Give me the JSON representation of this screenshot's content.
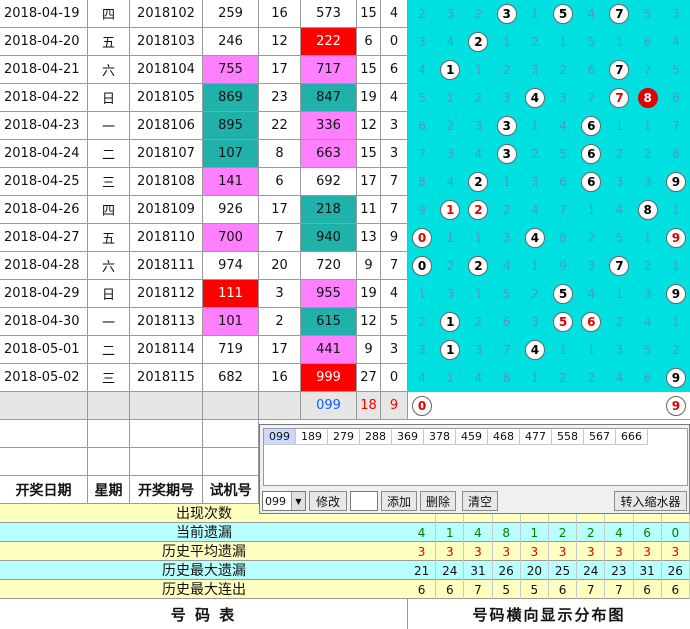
{
  "rows": [
    {
      "date": "2018-04-19",
      "week": "四",
      "period": "2018102",
      "test": "259",
      "span": "16",
      "win": "573",
      "sum": "15",
      "tail": "4",
      "test_style": "",
      "win_style": "",
      "dist": [
        {
          "t": "n",
          "v": "2"
        },
        {
          "t": "n",
          "v": "3"
        },
        {
          "t": "n",
          "v": "2"
        },
        {
          "t": "b",
          "v": "3"
        },
        {
          "t": "n",
          "v": "1"
        },
        {
          "t": "b",
          "v": "5"
        },
        {
          "t": "n",
          "v": "4"
        },
        {
          "t": "b",
          "v": "7"
        },
        {
          "t": "n",
          "v": "5"
        },
        {
          "t": "n",
          "v": "3"
        }
      ]
    },
    {
      "date": "2018-04-20",
      "week": "五",
      "period": "2018103",
      "test": "246",
      "span": "12",
      "win": "222",
      "sum": "6",
      "tail": "0",
      "test_style": "",
      "win_style": "red",
      "dist": [
        {
          "t": "n",
          "v": "3"
        },
        {
          "t": "n",
          "v": "4"
        },
        {
          "t": "b",
          "v": "2"
        },
        {
          "t": "n",
          "v": "1"
        },
        {
          "t": "n",
          "v": "2"
        },
        {
          "t": "n",
          "v": "1"
        },
        {
          "t": "n",
          "v": "5"
        },
        {
          "t": "n",
          "v": "1"
        },
        {
          "t": "n",
          "v": "6"
        },
        {
          "t": "n",
          "v": "4"
        }
      ]
    },
    {
      "date": "2018-04-21",
      "week": "六",
      "period": "2018104",
      "test": "755",
      "span": "17",
      "win": "717",
      "sum": "15",
      "tail": "6",
      "test_style": "pink",
      "win_style": "pink",
      "dist": [
        {
          "t": "n",
          "v": "4"
        },
        {
          "t": "b",
          "v": "1"
        },
        {
          "t": "n",
          "v": "1"
        },
        {
          "t": "n",
          "v": "2"
        },
        {
          "t": "n",
          "v": "3"
        },
        {
          "t": "n",
          "v": "2"
        },
        {
          "t": "n",
          "v": "6"
        },
        {
          "t": "b",
          "v": "7"
        },
        {
          "t": "n",
          "v": "7"
        },
        {
          "t": "n",
          "v": "5"
        }
      ]
    },
    {
      "date": "2018-04-22",
      "week": "日",
      "period": "2018105",
      "test": "869",
      "span": "23",
      "win": "847",
      "sum": "19",
      "tail": "4",
      "test_style": "teal",
      "win_style": "teal",
      "dist": [
        {
          "t": "n",
          "v": "5"
        },
        {
          "t": "n",
          "v": "1"
        },
        {
          "t": "n",
          "v": "2"
        },
        {
          "t": "n",
          "v": "3"
        },
        {
          "t": "b",
          "v": "4"
        },
        {
          "t": "n",
          "v": "3"
        },
        {
          "t": "n",
          "v": "7"
        },
        {
          "t": "r",
          "v": "7"
        },
        {
          "t": "f",
          "v": "8"
        },
        {
          "t": "n",
          "v": "6"
        }
      ]
    },
    {
      "date": "2018-04-23",
      "week": "一",
      "period": "2018106",
      "test": "895",
      "span": "22",
      "win": "336",
      "sum": "12",
      "tail": "3",
      "test_style": "teal",
      "win_style": "pink",
      "dist": [
        {
          "t": "n",
          "v": "6"
        },
        {
          "t": "n",
          "v": "2"
        },
        {
          "t": "n",
          "v": "3"
        },
        {
          "t": "b",
          "v": "3"
        },
        {
          "t": "n",
          "v": "1"
        },
        {
          "t": "n",
          "v": "4"
        },
        {
          "t": "b",
          "v": "6"
        },
        {
          "t": "n",
          "v": "1"
        },
        {
          "t": "n",
          "v": "1"
        },
        {
          "t": "n",
          "v": "7"
        }
      ]
    },
    {
      "date": "2018-04-24",
      "week": "二",
      "period": "2018107",
      "test": "107",
      "span": "8",
      "win": "663",
      "sum": "15",
      "tail": "3",
      "test_style": "teal",
      "win_style": "pink",
      "dist": [
        {
          "t": "n",
          "v": "7"
        },
        {
          "t": "n",
          "v": "3"
        },
        {
          "t": "n",
          "v": "4"
        },
        {
          "t": "b",
          "v": "3"
        },
        {
          "t": "n",
          "v": "2"
        },
        {
          "t": "n",
          "v": "5"
        },
        {
          "t": "b",
          "v": "6"
        },
        {
          "t": "n",
          "v": "2"
        },
        {
          "t": "n",
          "v": "2"
        },
        {
          "t": "n",
          "v": "8"
        }
      ]
    },
    {
      "date": "2018-04-25",
      "week": "三",
      "period": "2018108",
      "test": "141",
      "span": "6",
      "win": "692",
      "sum": "17",
      "tail": "7",
      "test_style": "pink",
      "win_style": "",
      "dist": [
        {
          "t": "n",
          "v": "8"
        },
        {
          "t": "n",
          "v": "4"
        },
        {
          "t": "b",
          "v": "2"
        },
        {
          "t": "n",
          "v": "1"
        },
        {
          "t": "n",
          "v": "3"
        },
        {
          "t": "n",
          "v": "6"
        },
        {
          "t": "b",
          "v": "6"
        },
        {
          "t": "n",
          "v": "3"
        },
        {
          "t": "n",
          "v": "3"
        },
        {
          "t": "b",
          "v": "9"
        }
      ]
    },
    {
      "date": "2018-04-26",
      "week": "四",
      "period": "2018109",
      "test": "926",
      "span": "17",
      "win": "218",
      "sum": "11",
      "tail": "7",
      "test_style": "",
      "win_style": "teal",
      "dist": [
        {
          "t": "n",
          "v": "9"
        },
        {
          "t": "r",
          "v": "1"
        },
        {
          "t": "r",
          "v": "2"
        },
        {
          "t": "n",
          "v": "2"
        },
        {
          "t": "n",
          "v": "4"
        },
        {
          "t": "n",
          "v": "7"
        },
        {
          "t": "n",
          "v": "1"
        },
        {
          "t": "n",
          "v": "4"
        },
        {
          "t": "b",
          "v": "8"
        },
        {
          "t": "n",
          "v": "1"
        }
      ]
    },
    {
      "date": "2018-04-27",
      "week": "五",
      "period": "2018110",
      "test": "700",
      "span": "7",
      "win": "940",
      "sum": "13",
      "tail": "9",
      "test_style": "pink",
      "win_style": "teal",
      "dist": [
        {
          "t": "r",
          "v": "0"
        },
        {
          "t": "n",
          "v": "1"
        },
        {
          "t": "n",
          "v": "1"
        },
        {
          "t": "n",
          "v": "3"
        },
        {
          "t": "b",
          "v": "4"
        },
        {
          "t": "n",
          "v": "8"
        },
        {
          "t": "n",
          "v": "2"
        },
        {
          "t": "n",
          "v": "5"
        },
        {
          "t": "n",
          "v": "1"
        },
        {
          "t": "r",
          "v": "9"
        }
      ]
    },
    {
      "date": "2018-04-28",
      "week": "六",
      "period": "2018111",
      "test": "974",
      "span": "20",
      "win": "720",
      "sum": "9",
      "tail": "7",
      "test_style": "",
      "win_style": "",
      "dist": [
        {
          "t": "b",
          "v": "0"
        },
        {
          "t": "n",
          "v": "2"
        },
        {
          "t": "b",
          "v": "2"
        },
        {
          "t": "n",
          "v": "4"
        },
        {
          "t": "n",
          "v": "1"
        },
        {
          "t": "n",
          "v": "9"
        },
        {
          "t": "n",
          "v": "3"
        },
        {
          "t": "b",
          "v": "7"
        },
        {
          "t": "n",
          "v": "2"
        },
        {
          "t": "n",
          "v": "1"
        }
      ]
    },
    {
      "date": "2018-04-29",
      "week": "日",
      "period": "2018112",
      "test": "111",
      "span": "3",
      "win": "955",
      "sum": "19",
      "tail": "4",
      "test_style": "red",
      "win_style": "pink",
      "dist": [
        {
          "t": "n",
          "v": "1"
        },
        {
          "t": "n",
          "v": "3"
        },
        {
          "t": "n",
          "v": "1"
        },
        {
          "t": "n",
          "v": "5"
        },
        {
          "t": "n",
          "v": "2"
        },
        {
          "t": "b",
          "v": "5"
        },
        {
          "t": "n",
          "v": "4"
        },
        {
          "t": "n",
          "v": "1"
        },
        {
          "t": "n",
          "v": "3"
        },
        {
          "t": "b",
          "v": "9"
        }
      ]
    },
    {
      "date": "2018-04-30",
      "week": "一",
      "period": "2018113",
      "test": "101",
      "span": "2",
      "win": "615",
      "sum": "12",
      "tail": "5",
      "test_style": "pink",
      "win_style": "teal",
      "dist": [
        {
          "t": "n",
          "v": "2"
        },
        {
          "t": "b",
          "v": "1"
        },
        {
          "t": "n",
          "v": "2"
        },
        {
          "t": "n",
          "v": "6"
        },
        {
          "t": "n",
          "v": "3"
        },
        {
          "t": "r",
          "v": "5"
        },
        {
          "t": "r",
          "v": "6"
        },
        {
          "t": "n",
          "v": "2"
        },
        {
          "t": "n",
          "v": "4"
        },
        {
          "t": "n",
          "v": "1"
        }
      ]
    },
    {
      "date": "2018-05-01",
      "week": "二",
      "period": "2018114",
      "test": "719",
      "span": "17",
      "win": "441",
      "sum": "9",
      "tail": "3",
      "test_style": "",
      "win_style": "pink",
      "dist": [
        {
          "t": "n",
          "v": "3"
        },
        {
          "t": "b",
          "v": "1"
        },
        {
          "t": "n",
          "v": "3"
        },
        {
          "t": "n",
          "v": "7"
        },
        {
          "t": "b",
          "v": "4"
        },
        {
          "t": "n",
          "v": "1"
        },
        {
          "t": "n",
          "v": "1"
        },
        {
          "t": "n",
          "v": "3"
        },
        {
          "t": "n",
          "v": "5"
        },
        {
          "t": "n",
          "v": "2"
        }
      ]
    },
    {
      "date": "2018-05-02",
      "week": "三",
      "period": "2018115",
      "test": "682",
      "span": "16",
      "win": "999",
      "sum": "27",
      "tail": "0",
      "test_style": "",
      "win_style": "red",
      "dist": [
        {
          "t": "n",
          "v": "4"
        },
        {
          "t": "n",
          "v": "1"
        },
        {
          "t": "n",
          "v": "4"
        },
        {
          "t": "n",
          "v": "8"
        },
        {
          "t": "n",
          "v": "1"
        },
        {
          "t": "n",
          "v": "2"
        },
        {
          "t": "n",
          "v": "2"
        },
        {
          "t": "n",
          "v": "4"
        },
        {
          "t": "n",
          "v": "6"
        },
        {
          "t": "b",
          "v": "9"
        }
      ]
    }
  ],
  "prediction": {
    "win": "099",
    "sum": "18",
    "tail": "9",
    "ball_left": "0",
    "ball_right": "9"
  },
  "headers": {
    "date": "开奖日期",
    "week": "星期",
    "period": "开奖期号",
    "test": "试机号"
  },
  "panel": {
    "combos": [
      "099",
      "189",
      "279",
      "288",
      "369",
      "378",
      "459",
      "468",
      "477",
      "558",
      "567",
      "666"
    ],
    "select_value": "099",
    "modify": "修改",
    "add": "添加",
    "delete": "删除",
    "clear": "清空",
    "transfer": "转入缩水器"
  },
  "stats": [
    {
      "label": "出现次数",
      "values": [
        "",
        "",
        "",
        "",
        "",
        "",
        "",
        "",
        "",
        ""
      ],
      "bg": "yellow"
    },
    {
      "label": "当前遗漏",
      "values": [
        "4",
        "1",
        "4",
        "8",
        "1",
        "2",
        "2",
        "4",
        "6",
        "0"
      ],
      "bg": "cyan",
      "color": "green"
    },
    {
      "label": "历史平均遗漏",
      "values": [
        "3",
        "3",
        "3",
        "3",
        "3",
        "3",
        "3",
        "3",
        "3",
        "3"
      ],
      "bg": "yellow",
      "color": "red"
    },
    {
      "label": "历史最大遗漏",
      "values": [
        "21",
        "24",
        "31",
        "26",
        "20",
        "25",
        "24",
        "23",
        "31",
        "26"
      ],
      "bg": "cyan",
      "color": ""
    },
    {
      "label": "历史最大连出",
      "values": [
        "6",
        "6",
        "7",
        "5",
        "5",
        "6",
        "7",
        "7",
        "6",
        "6"
      ],
      "bg": "yellow",
      "color": ""
    }
  ],
  "footer": {
    "left": "号   码   表",
    "right": "号码横向显示分布图"
  }
}
